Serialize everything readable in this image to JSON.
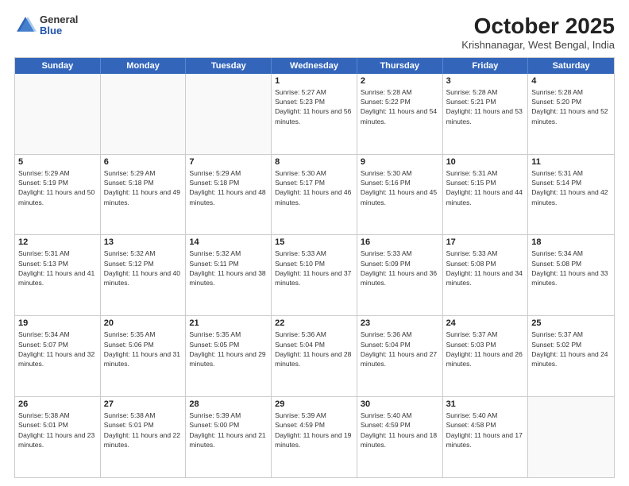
{
  "header": {
    "logo": {
      "general": "General",
      "blue": "Blue"
    },
    "title": "October 2025",
    "location": "Krishnanagar, West Bengal, India"
  },
  "weekdays": [
    "Sunday",
    "Monday",
    "Tuesday",
    "Wednesday",
    "Thursday",
    "Friday",
    "Saturday"
  ],
  "rows": [
    [
      {
        "day": "",
        "sunrise": "",
        "sunset": "",
        "daylight": ""
      },
      {
        "day": "",
        "sunrise": "",
        "sunset": "",
        "daylight": ""
      },
      {
        "day": "",
        "sunrise": "",
        "sunset": "",
        "daylight": ""
      },
      {
        "day": "1",
        "sunrise": "Sunrise: 5:27 AM",
        "sunset": "Sunset: 5:23 PM",
        "daylight": "Daylight: 11 hours and 56 minutes."
      },
      {
        "day": "2",
        "sunrise": "Sunrise: 5:28 AM",
        "sunset": "Sunset: 5:22 PM",
        "daylight": "Daylight: 11 hours and 54 minutes."
      },
      {
        "day": "3",
        "sunrise": "Sunrise: 5:28 AM",
        "sunset": "Sunset: 5:21 PM",
        "daylight": "Daylight: 11 hours and 53 minutes."
      },
      {
        "day": "4",
        "sunrise": "Sunrise: 5:28 AM",
        "sunset": "Sunset: 5:20 PM",
        "daylight": "Daylight: 11 hours and 52 minutes."
      }
    ],
    [
      {
        "day": "5",
        "sunrise": "Sunrise: 5:29 AM",
        "sunset": "Sunset: 5:19 PM",
        "daylight": "Daylight: 11 hours and 50 minutes."
      },
      {
        "day": "6",
        "sunrise": "Sunrise: 5:29 AM",
        "sunset": "Sunset: 5:18 PM",
        "daylight": "Daylight: 11 hours and 49 minutes."
      },
      {
        "day": "7",
        "sunrise": "Sunrise: 5:29 AM",
        "sunset": "Sunset: 5:18 PM",
        "daylight": "Daylight: 11 hours and 48 minutes."
      },
      {
        "day": "8",
        "sunrise": "Sunrise: 5:30 AM",
        "sunset": "Sunset: 5:17 PM",
        "daylight": "Daylight: 11 hours and 46 minutes."
      },
      {
        "day": "9",
        "sunrise": "Sunrise: 5:30 AM",
        "sunset": "Sunset: 5:16 PM",
        "daylight": "Daylight: 11 hours and 45 minutes."
      },
      {
        "day": "10",
        "sunrise": "Sunrise: 5:31 AM",
        "sunset": "Sunset: 5:15 PM",
        "daylight": "Daylight: 11 hours and 44 minutes."
      },
      {
        "day": "11",
        "sunrise": "Sunrise: 5:31 AM",
        "sunset": "Sunset: 5:14 PM",
        "daylight": "Daylight: 11 hours and 42 minutes."
      }
    ],
    [
      {
        "day": "12",
        "sunrise": "Sunrise: 5:31 AM",
        "sunset": "Sunset: 5:13 PM",
        "daylight": "Daylight: 11 hours and 41 minutes."
      },
      {
        "day": "13",
        "sunrise": "Sunrise: 5:32 AM",
        "sunset": "Sunset: 5:12 PM",
        "daylight": "Daylight: 11 hours and 40 minutes."
      },
      {
        "day": "14",
        "sunrise": "Sunrise: 5:32 AM",
        "sunset": "Sunset: 5:11 PM",
        "daylight": "Daylight: 11 hours and 38 minutes."
      },
      {
        "day": "15",
        "sunrise": "Sunrise: 5:33 AM",
        "sunset": "Sunset: 5:10 PM",
        "daylight": "Daylight: 11 hours and 37 minutes."
      },
      {
        "day": "16",
        "sunrise": "Sunrise: 5:33 AM",
        "sunset": "Sunset: 5:09 PM",
        "daylight": "Daylight: 11 hours and 36 minutes."
      },
      {
        "day": "17",
        "sunrise": "Sunrise: 5:33 AM",
        "sunset": "Sunset: 5:08 PM",
        "daylight": "Daylight: 11 hours and 34 minutes."
      },
      {
        "day": "18",
        "sunrise": "Sunrise: 5:34 AM",
        "sunset": "Sunset: 5:08 PM",
        "daylight": "Daylight: 11 hours and 33 minutes."
      }
    ],
    [
      {
        "day": "19",
        "sunrise": "Sunrise: 5:34 AM",
        "sunset": "Sunset: 5:07 PM",
        "daylight": "Daylight: 11 hours and 32 minutes."
      },
      {
        "day": "20",
        "sunrise": "Sunrise: 5:35 AM",
        "sunset": "Sunset: 5:06 PM",
        "daylight": "Daylight: 11 hours and 31 minutes."
      },
      {
        "day": "21",
        "sunrise": "Sunrise: 5:35 AM",
        "sunset": "Sunset: 5:05 PM",
        "daylight": "Daylight: 11 hours and 29 minutes."
      },
      {
        "day": "22",
        "sunrise": "Sunrise: 5:36 AM",
        "sunset": "Sunset: 5:04 PM",
        "daylight": "Daylight: 11 hours and 28 minutes."
      },
      {
        "day": "23",
        "sunrise": "Sunrise: 5:36 AM",
        "sunset": "Sunset: 5:04 PM",
        "daylight": "Daylight: 11 hours and 27 minutes."
      },
      {
        "day": "24",
        "sunrise": "Sunrise: 5:37 AM",
        "sunset": "Sunset: 5:03 PM",
        "daylight": "Daylight: 11 hours and 26 minutes."
      },
      {
        "day": "25",
        "sunrise": "Sunrise: 5:37 AM",
        "sunset": "Sunset: 5:02 PM",
        "daylight": "Daylight: 11 hours and 24 minutes."
      }
    ],
    [
      {
        "day": "26",
        "sunrise": "Sunrise: 5:38 AM",
        "sunset": "Sunset: 5:01 PM",
        "daylight": "Daylight: 11 hours and 23 minutes."
      },
      {
        "day": "27",
        "sunrise": "Sunrise: 5:38 AM",
        "sunset": "Sunset: 5:01 PM",
        "daylight": "Daylight: 11 hours and 22 minutes."
      },
      {
        "day": "28",
        "sunrise": "Sunrise: 5:39 AM",
        "sunset": "Sunset: 5:00 PM",
        "daylight": "Daylight: 11 hours and 21 minutes."
      },
      {
        "day": "29",
        "sunrise": "Sunrise: 5:39 AM",
        "sunset": "Sunset: 4:59 PM",
        "daylight": "Daylight: 11 hours and 19 minutes."
      },
      {
        "day": "30",
        "sunrise": "Sunrise: 5:40 AM",
        "sunset": "Sunset: 4:59 PM",
        "daylight": "Daylight: 11 hours and 18 minutes."
      },
      {
        "day": "31",
        "sunrise": "Sunrise: 5:40 AM",
        "sunset": "Sunset: 4:58 PM",
        "daylight": "Daylight: 11 hours and 17 minutes."
      },
      {
        "day": "",
        "sunrise": "",
        "sunset": "",
        "daylight": ""
      }
    ]
  ]
}
